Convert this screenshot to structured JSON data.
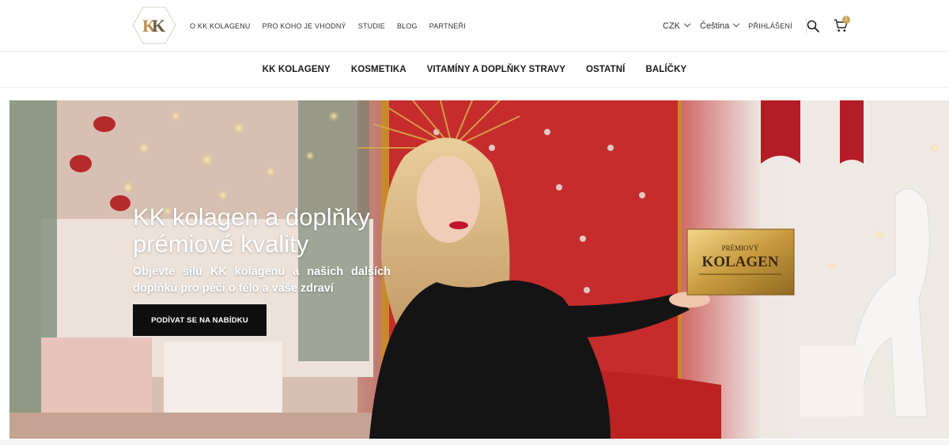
{
  "header": {
    "logo_alt": "KK",
    "nav": [
      {
        "label": "O KK KOLAGENU"
      },
      {
        "label": "PRO KOHO JE VHODNÝ"
      },
      {
        "label": "STUDIE"
      },
      {
        "label": "BLOG"
      },
      {
        "label": "PARTNEŘI"
      }
    ],
    "currency": "CZK",
    "language": "Čeština",
    "login": "PŘIHLÁŠENÍ",
    "cart_count": "1",
    "icons": [
      "search-icon",
      "cart-icon",
      "chevron-down-icon"
    ]
  },
  "categories": [
    {
      "label": "KK KOLAGENY"
    },
    {
      "label": "KOSMETIKA"
    },
    {
      "label": "VITAMÍNY A DOPLŇKY STRAVY"
    },
    {
      "label": "OSTATNÍ"
    },
    {
      "label": "BALÍČKY"
    }
  ],
  "hero": {
    "title": "KK kolagen a doplňky prémiové kvality",
    "subtitle": "Objevte sílu KK kolagenu a našich dalších doplňků pro péči o tělo a vaše zdraví",
    "cta": "PODÍVAT SE NA NABÍDKU",
    "product_box": {
      "line1": "PRÉMIOVÝ",
      "line2": "KOLAGEN"
    }
  },
  "colors": {
    "accent_gold": "#c9a15d",
    "cta_bg": "#0e0e0e",
    "throne_red": "#c02a2a"
  }
}
